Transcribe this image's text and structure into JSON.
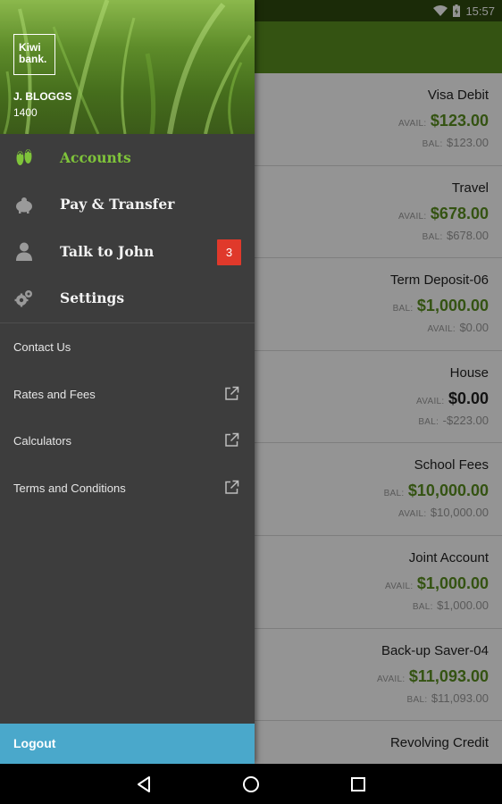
{
  "status_bar": {
    "time": "15:57"
  },
  "drawer": {
    "logo_line1": "Kiwi",
    "logo_line2": "bank.",
    "user_name": "J. BLOGGS",
    "user_number": "1400",
    "main_items": [
      {
        "label": "Accounts",
        "icon": "jandals-icon",
        "active": true
      },
      {
        "label": "Pay & Transfer",
        "icon": "piggy-bank-icon"
      },
      {
        "label": "Talk to John",
        "icon": "person-icon",
        "badge": "3"
      },
      {
        "label": "Settings",
        "icon": "gears-icon"
      }
    ],
    "secondary_items": [
      {
        "label": "Contact Us"
      },
      {
        "label": "Rates and Fees",
        "external": true
      },
      {
        "label": "Calculators",
        "external": true
      },
      {
        "label": "Terms and Conditions",
        "external": true
      }
    ],
    "logout_label": "Logout"
  },
  "accounts": [
    {
      "name": "Visa Debit",
      "primary_label": "AVAIL:",
      "primary_amount": "$123.00",
      "secondary_label": "BAL:",
      "secondary_amount": "$123.00"
    },
    {
      "name": "Travel",
      "primary_label": "AVAIL:",
      "primary_amount": "$678.00",
      "secondary_label": "BAL:",
      "secondary_amount": "$678.00"
    },
    {
      "name": "Term Deposit-06",
      "primary_label": "BAL:",
      "primary_amount": "$1,000.00",
      "secondary_label": "AVAIL:",
      "secondary_amount": "$0.00"
    },
    {
      "name": "House",
      "primary_label": "AVAIL:",
      "primary_amount": "$0.00",
      "secondary_label": "BAL:",
      "secondary_amount": "-$223.00",
      "primary_dark": true
    },
    {
      "name": "School Fees",
      "primary_label": "BAL:",
      "primary_amount": "$10,000.00",
      "secondary_label": "AVAIL:",
      "secondary_amount": "$10,000.00"
    },
    {
      "name": "Joint Account",
      "primary_label": "AVAIL:",
      "primary_amount": "$1,000.00",
      "secondary_label": "BAL:",
      "secondary_amount": "$1,000.00"
    },
    {
      "name": "Back-up Saver-04",
      "primary_label": "AVAIL:",
      "primary_amount": "$11,093.00",
      "secondary_label": "BAL:",
      "secondary_amount": "$11,093.00"
    },
    {
      "name": "Revolving Credit",
      "primary_label": "",
      "primary_amount": "",
      "secondary_label": "",
      "secondary_amount": ""
    }
  ],
  "colors": {
    "accent_green": "#7fc43a",
    "amount_green": "#5b8f1f",
    "badge_red": "#e0392b",
    "logout_blue": "#4aa8cb",
    "drawer_bg": "#3d3d3d"
  }
}
